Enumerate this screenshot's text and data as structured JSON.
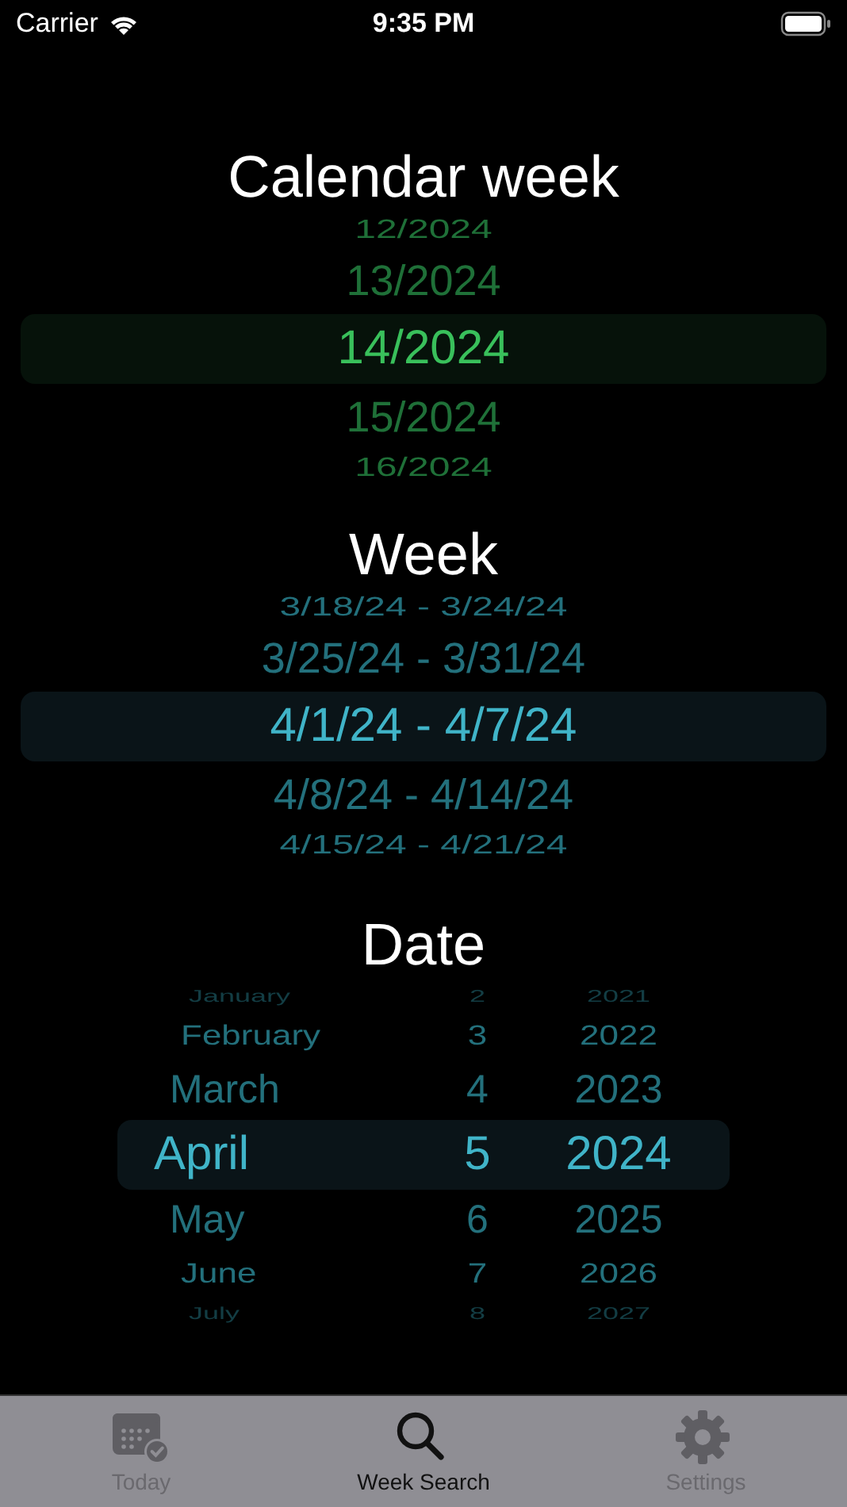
{
  "status_bar": {
    "carrier": "Carrier",
    "time": "9:35 PM"
  },
  "pickers": [
    {
      "kind": "week-number",
      "title": "Calendar week",
      "rows": [
        {
          "text": "12/2024",
          "selected": false
        },
        {
          "text": "13/2024",
          "selected": false
        },
        {
          "text": "14/2024",
          "selected": true
        },
        {
          "text": "15/2024",
          "selected": false
        },
        {
          "text": "16/2024",
          "selected": false
        }
      ]
    },
    {
      "kind": "week-range",
      "title": "Week",
      "rows": [
        {
          "text": "3/18/24 - 3/24/24",
          "selected": false
        },
        {
          "text": "3/25/24 - 3/31/24",
          "selected": false
        },
        {
          "text": "4/1/24 - 4/7/24",
          "selected": true
        },
        {
          "text": "4/8/24 - 4/14/24",
          "selected": false
        },
        {
          "text": "4/15/24 - 4/21/24",
          "selected": false
        }
      ]
    }
  ],
  "date_picker": {
    "title": "Date",
    "columns": [
      {
        "kind": "month",
        "rows": [
          {
            "text": "January",
            "selected": false
          },
          {
            "text": "February",
            "selected": false
          },
          {
            "text": "March",
            "selected": false
          },
          {
            "text": "April",
            "selected": true
          },
          {
            "text": "May",
            "selected": false
          },
          {
            "text": "June",
            "selected": false
          },
          {
            "text": "July",
            "selected": false
          }
        ]
      },
      {
        "kind": "day",
        "rows": [
          {
            "text": "2",
            "selected": false
          },
          {
            "text": "3",
            "selected": false
          },
          {
            "text": "4",
            "selected": false
          },
          {
            "text": "5",
            "selected": true
          },
          {
            "text": "6",
            "selected": false
          },
          {
            "text": "7",
            "selected": false
          },
          {
            "text": "8",
            "selected": false
          }
        ]
      },
      {
        "kind": "year",
        "rows": [
          {
            "text": "2021",
            "selected": false
          },
          {
            "text": "2022",
            "selected": false
          },
          {
            "text": "2023",
            "selected": false
          },
          {
            "text": "2024",
            "selected": true
          },
          {
            "text": "2025",
            "selected": false
          },
          {
            "text": "2026",
            "selected": false
          },
          {
            "text": "2027",
            "selected": false
          }
        ]
      }
    ]
  },
  "tab_bar": [
    {
      "kind": "today",
      "label": "Today",
      "selected": false
    },
    {
      "kind": "search",
      "label": "Week Search",
      "selected": true
    },
    {
      "kind": "settings",
      "label": "Settings",
      "selected": false
    }
  ]
}
